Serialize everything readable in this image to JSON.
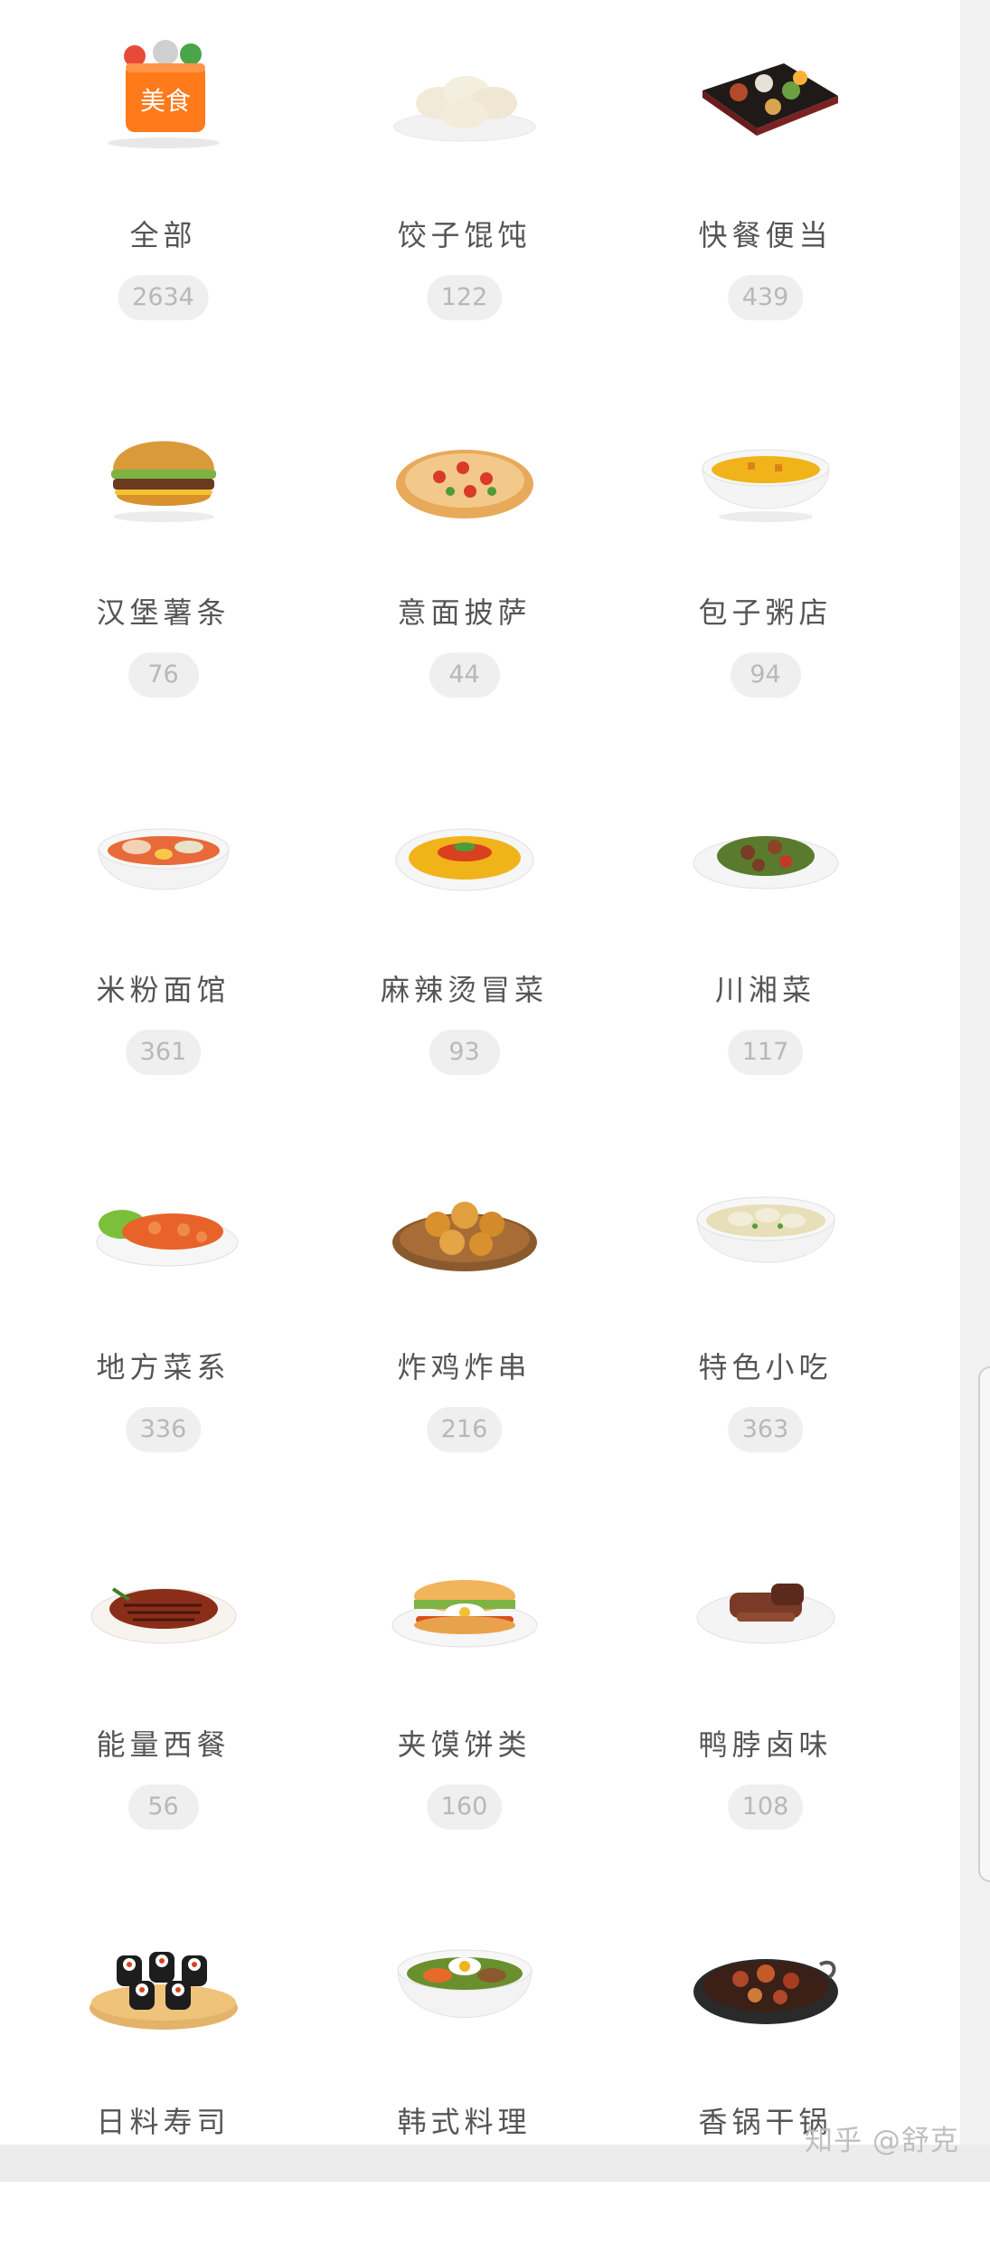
{
  "categories": [
    {
      "label": "全部",
      "count": "2634",
      "icon": "all-food-bag-icon",
      "badge_text": "美食"
    },
    {
      "label": "饺子馄饨",
      "count": "122",
      "icon": "dumplings-icon"
    },
    {
      "label": "快餐便当",
      "count": "439",
      "icon": "bento-box-icon"
    },
    {
      "label": "汉堡薯条",
      "count": "76",
      "icon": "burger-icon"
    },
    {
      "label": "意面披萨",
      "count": "44",
      "icon": "pizza-icon"
    },
    {
      "label": "包子粥店",
      "count": "94",
      "icon": "congee-bowl-icon"
    },
    {
      "label": "米粉面馆",
      "count": "361",
      "icon": "noodle-bowl-icon"
    },
    {
      "label": "麻辣烫冒菜",
      "count": "93",
      "icon": "spicy-hotpot-bowl-icon"
    },
    {
      "label": "川湘菜",
      "count": "117",
      "icon": "stir-fry-plate-icon"
    },
    {
      "label": "地方菜系",
      "count": "336",
      "icon": "shrimp-plate-icon"
    },
    {
      "label": "炸鸡炸串",
      "count": "216",
      "icon": "fried-chicken-icon"
    },
    {
      "label": "特色小吃",
      "count": "363",
      "icon": "wonton-soup-icon"
    },
    {
      "label": "能量西餐",
      "count": "56",
      "icon": "steak-icon"
    },
    {
      "label": "夹馍饼类",
      "count": "160",
      "icon": "sandwich-icon"
    },
    {
      "label": "鸭脖卤味",
      "count": "108",
      "icon": "braised-meat-icon"
    },
    {
      "label": "日料寿司",
      "count": "",
      "icon": "sushi-icon"
    },
    {
      "label": "韩式料理",
      "count": "",
      "icon": "bibimbap-icon"
    },
    {
      "label": "香锅干锅",
      "count": "",
      "icon": "dry-pot-icon"
    }
  ],
  "watermark": "知乎 @舒克",
  "colors": {
    "accent": "#ff7a1a",
    "label_text": "#555555",
    "badge_bg": "#efefef",
    "badge_text": "#b8b8b8"
  }
}
